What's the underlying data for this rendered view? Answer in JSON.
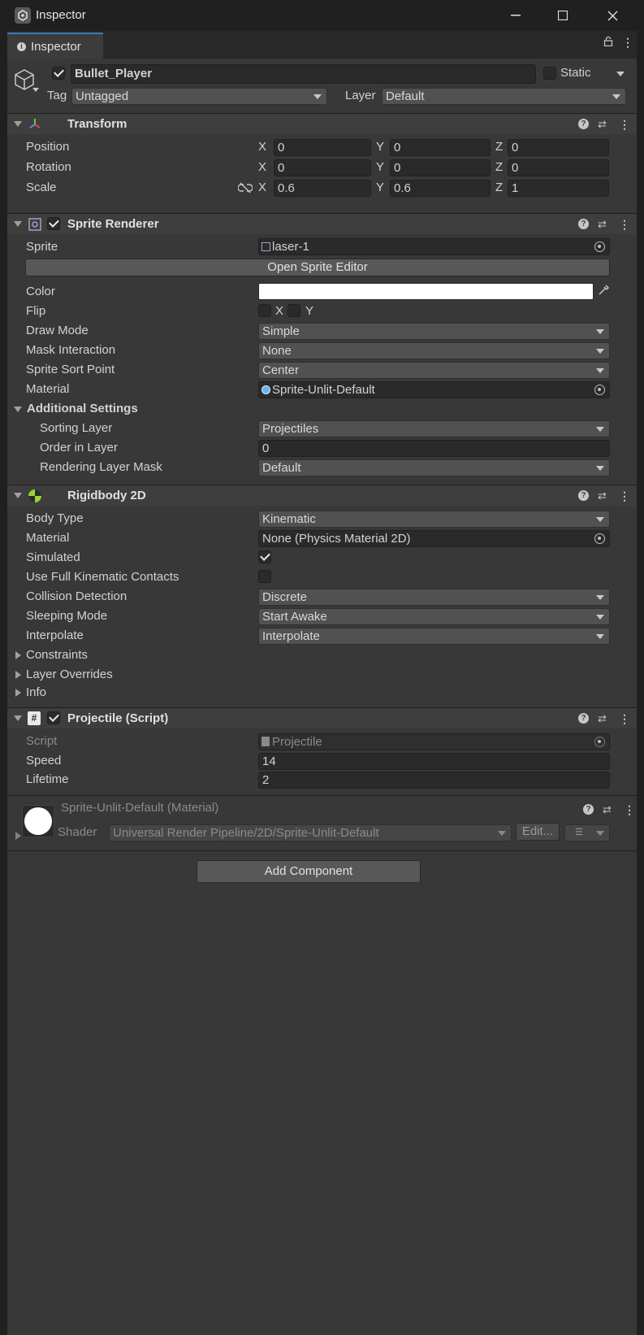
{
  "window": {
    "title": "Inspector",
    "tab": "Inspector"
  },
  "object": {
    "name": "Bullet_Player",
    "static_label": "Static",
    "tag_label": "Tag",
    "tag": "Untagged",
    "layer_label": "Layer",
    "layer": "Default"
  },
  "transform": {
    "title": "Transform",
    "position": {
      "label": "Position",
      "x": "0",
      "y": "0",
      "z": "0"
    },
    "rotation": {
      "label": "Rotation",
      "x": "0",
      "y": "0",
      "z": "0"
    },
    "scale": {
      "label": "Scale",
      "x": "0.6",
      "y": "0.6",
      "z": "1"
    },
    "axis": {
      "x": "X",
      "y": "Y",
      "z": "Z"
    }
  },
  "sprite_renderer": {
    "title": "Sprite Renderer",
    "sprite_label": "Sprite",
    "sprite": "laser-1",
    "open_editor": "Open Sprite Editor",
    "color_label": "Color",
    "color_value": "#ffffff",
    "flip_label": "Flip",
    "flip_x": "X",
    "flip_y": "Y",
    "draw_mode_label": "Draw Mode",
    "draw_mode": "Simple",
    "mask_label": "Mask Interaction",
    "mask": "None",
    "sort_point_label": "Sprite Sort Point",
    "sort_point": "Center",
    "material_label": "Material",
    "material": "Sprite-Unlit-Default",
    "additional_label": "Additional Settings",
    "sorting_layer_label": "Sorting Layer",
    "sorting_layer": "Projectiles",
    "order_label": "Order in Layer",
    "order": "0",
    "rlm_label": "Rendering Layer Mask",
    "rlm": "Default"
  },
  "rigidbody": {
    "title": "Rigidbody 2D",
    "body_type_label": "Body Type",
    "body_type": "Kinematic",
    "material_label": "Material",
    "material": "None (Physics Material 2D)",
    "simulated_label": "Simulated",
    "full_kin_label": "Use Full Kinematic Contacts",
    "collision_label": "Collision Detection",
    "collision": "Discrete",
    "sleeping_label": "Sleeping Mode",
    "sleeping": "Start Awake",
    "interpolate_label": "Interpolate",
    "interpolate": "Interpolate",
    "constraints": "Constraints",
    "layer_overrides": "Layer Overrides",
    "info": "Info"
  },
  "projectile": {
    "title": "Projectile (Script)",
    "script_label": "Script",
    "script": "Projectile",
    "speed_label": "Speed",
    "speed": "14",
    "lifetime_label": "Lifetime",
    "lifetime": "2"
  },
  "material_section": {
    "title": "Sprite-Unlit-Default (Material)",
    "shader_label": "Shader",
    "shader": "Universal Render Pipeline/2D/Sprite-Unlit-Default",
    "edit": "Edit..."
  },
  "add_component": "Add Component"
}
